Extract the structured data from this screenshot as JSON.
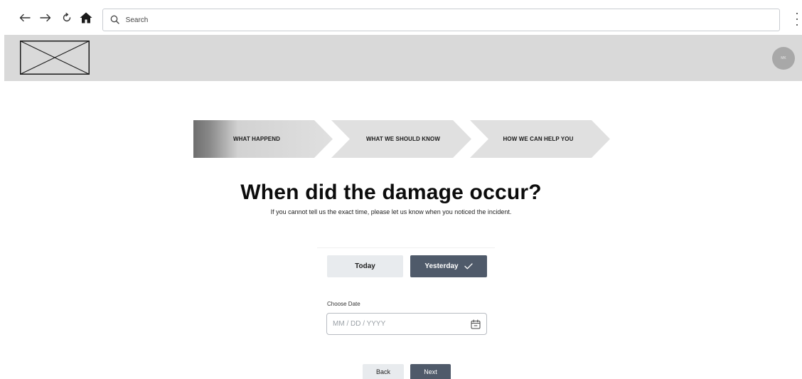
{
  "browser": {
    "search_placeholder": "Search"
  },
  "header": {
    "avatar_initials": "MK"
  },
  "stepper": {
    "steps": [
      {
        "label": "WHAT HAPPEND",
        "active": true
      },
      {
        "label": "WHAT WE SHOULD KNOW",
        "active": false
      },
      {
        "label": "HOW WE CAN HELP YOU",
        "active": false
      }
    ]
  },
  "question": {
    "title": "When did the damage occur?",
    "subtitle": "If you cannot tell us the exact time, please let us know when you noticed the incident."
  },
  "day_choice": {
    "today_label": "Today",
    "yesterday_label": "Yesterday",
    "selected": "Yesterday"
  },
  "date": {
    "label": "Choose Date",
    "placeholder": "MM / DD / YYYY"
  },
  "actions": {
    "back_label": "Back",
    "next_label": "Next"
  },
  "colors": {
    "primary": "#4f5a6a",
    "secondary": "#e8ebee",
    "header_bg": "#d9d9d9",
    "step_bg": "#e0e0e0"
  },
  "icons": {
    "back": "arrow-left-icon",
    "forward": "arrow-right-icon",
    "reload": "reload-icon",
    "home": "home-icon",
    "search": "search-icon",
    "menu": "kebab-menu-icon",
    "calendar": "calendar-icon",
    "check": "checkmark-icon"
  }
}
